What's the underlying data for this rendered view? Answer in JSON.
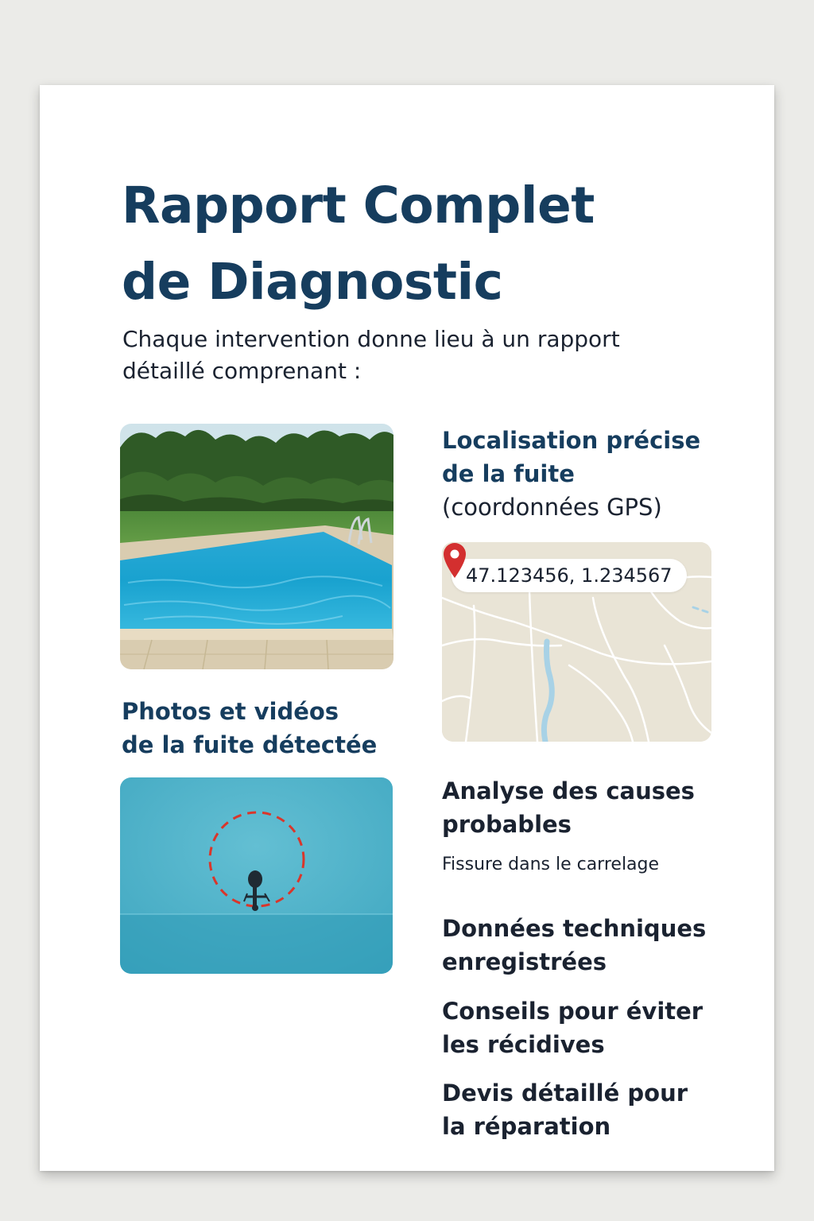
{
  "title": {
    "line1": "Rapport Complet",
    "line2": "de Diagnostic"
  },
  "intro": {
    "line1": "Chaque intervention donne lieu à un rapport",
    "line2": "détaillé comprenant :"
  },
  "localisation": {
    "line1": "Localisation précise",
    "line2": "de la fuite",
    "line3": "(coordonnées GPS)",
    "coordinates": "47.123456, 1.234567"
  },
  "photos": {
    "line1": "Photos et vidéos",
    "line2": "de la fuite détectée"
  },
  "analyse": {
    "line1": "Analyse des causes",
    "line2": "probables",
    "cause": "Fissure dans le carrelage"
  },
  "donnees": {
    "line1": "Données techniques",
    "line2": "enregistrées"
  },
  "conseils": {
    "line1": "Conseils pour éviter",
    "line2": "les récidives"
  },
  "devis": {
    "line1": "Devis détaillé pour",
    "line2": "la réparation"
  },
  "colors": {
    "heading": "#163d5e",
    "pin": "#d32f2f",
    "pool_water": "#1fa3c9",
    "map_background": "#e9e4d6"
  }
}
